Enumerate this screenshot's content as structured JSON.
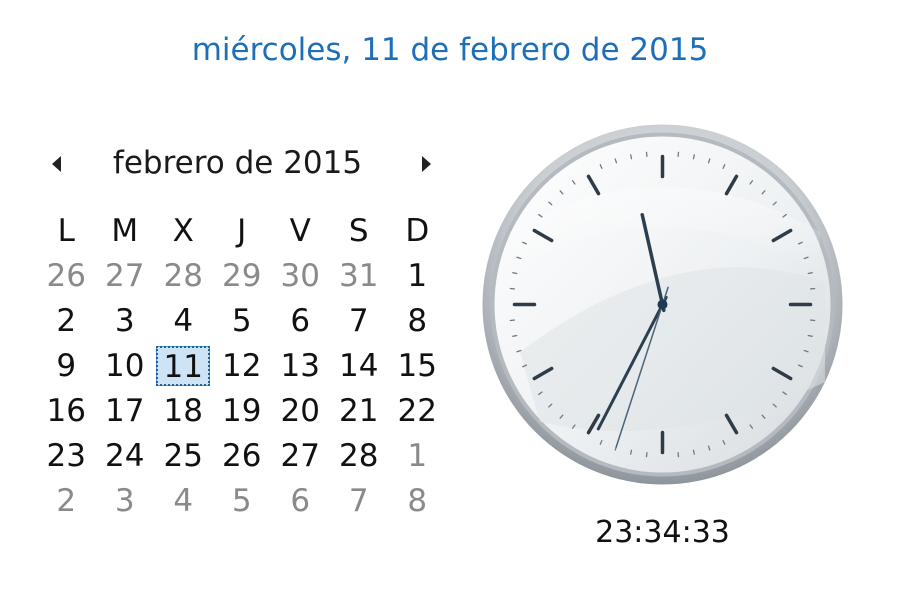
{
  "header": {
    "full_date": "miércoles, 11 de febrero de 2015"
  },
  "calendar": {
    "month_title": "febrero de 2015",
    "weekdays": [
      "L",
      "M",
      "X",
      "J",
      "V",
      "S",
      "D"
    ],
    "weeks": [
      [
        {
          "d": "26",
          "other": true
        },
        {
          "d": "27",
          "other": true
        },
        {
          "d": "28",
          "other": true
        },
        {
          "d": "29",
          "other": true
        },
        {
          "d": "30",
          "other": true
        },
        {
          "d": "31",
          "other": true
        },
        {
          "d": "1",
          "other": false
        }
      ],
      [
        {
          "d": "2",
          "other": false
        },
        {
          "d": "3",
          "other": false
        },
        {
          "d": "4",
          "other": false
        },
        {
          "d": "5",
          "other": false
        },
        {
          "d": "6",
          "other": false
        },
        {
          "d": "7",
          "other": false
        },
        {
          "d": "8",
          "other": false
        }
      ],
      [
        {
          "d": "9",
          "other": false
        },
        {
          "d": "10",
          "other": false
        },
        {
          "d": "11",
          "other": false,
          "today": true
        },
        {
          "d": "12",
          "other": false
        },
        {
          "d": "13",
          "other": false
        },
        {
          "d": "14",
          "other": false
        },
        {
          "d": "15",
          "other": false
        }
      ],
      [
        {
          "d": "16",
          "other": false
        },
        {
          "d": "17",
          "other": false
        },
        {
          "d": "18",
          "other": false
        },
        {
          "d": "19",
          "other": false
        },
        {
          "d": "20",
          "other": false
        },
        {
          "d": "21",
          "other": false
        },
        {
          "d": "22",
          "other": false
        }
      ],
      [
        {
          "d": "23",
          "other": false
        },
        {
          "d": "24",
          "other": false
        },
        {
          "d": "25",
          "other": false
        },
        {
          "d": "26",
          "other": false
        },
        {
          "d": "27",
          "other": false
        },
        {
          "d": "28",
          "other": false
        },
        {
          "d": "1",
          "other": true
        }
      ],
      [
        {
          "d": "2",
          "other": true
        },
        {
          "d": "3",
          "other": true
        },
        {
          "d": "4",
          "other": true
        },
        {
          "d": "5",
          "other": true
        },
        {
          "d": "6",
          "other": true
        },
        {
          "d": "7",
          "other": true
        },
        {
          "d": "8",
          "other": true
        }
      ]
    ],
    "icons": {
      "prev": "triangle-left-icon",
      "next": "triangle-right-icon"
    }
  },
  "clock": {
    "time_text": "23:34:33",
    "hours": 23,
    "minutes": 34,
    "seconds": 33,
    "colors": {
      "hands": "#2b3f50",
      "second_hand": "#4a6478",
      "accent": "#1e6fb8"
    }
  }
}
